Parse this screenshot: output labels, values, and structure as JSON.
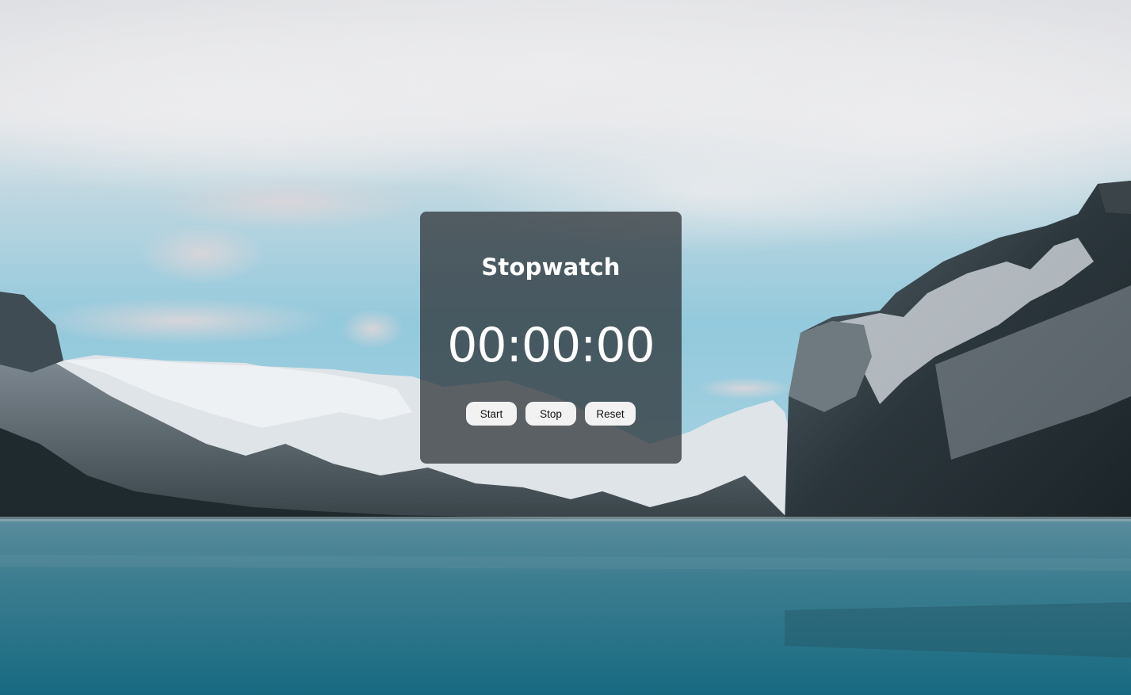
{
  "stopwatch": {
    "title": "Stopwatch",
    "time": "00:00:00",
    "buttons": {
      "start": "Start",
      "stop": "Stop",
      "reset": "Reset"
    }
  },
  "background": {
    "scene": "snowy mountains over a lake",
    "colors": {
      "sky_top": "#e4e5e8",
      "sky_blue": "#8fc6d9",
      "mountain_dark": "#2d3a40",
      "snow": "#e9ecef",
      "lake_top": "#4d8597",
      "lake_bottom": "#1d6a80"
    }
  },
  "card": {
    "background": "#282c30"
  }
}
